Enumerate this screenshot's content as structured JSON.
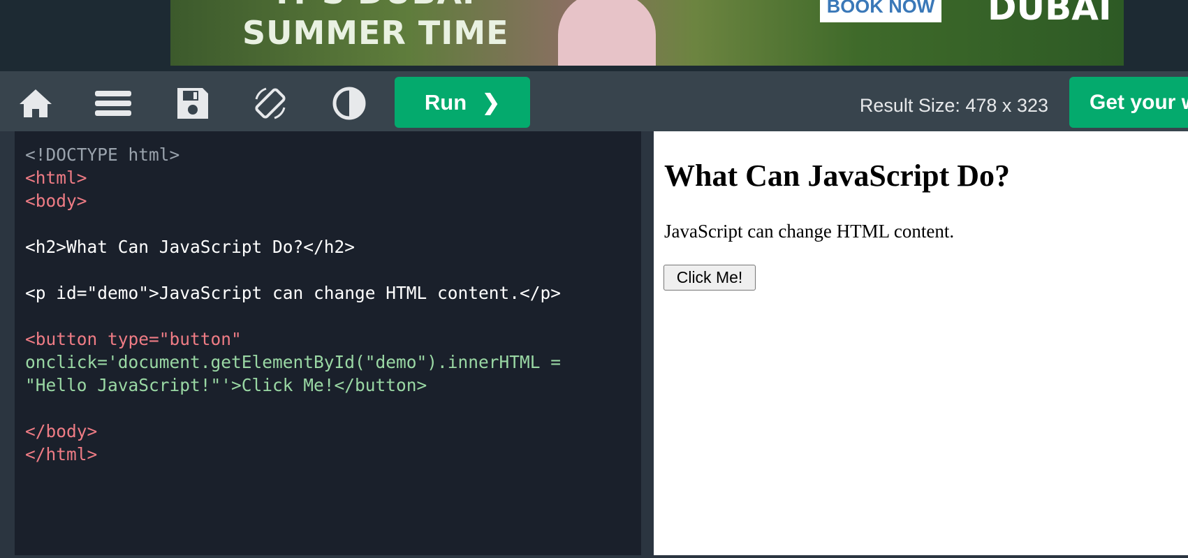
{
  "ad": {
    "line1": "IT'S DUBAI",
    "line2": "SUMMER TIME",
    "book_button": "BOOK NOW",
    "brand": "DUBAI"
  },
  "toolbar": {
    "run_label": "Run",
    "run_arrow": "❯",
    "result_size": "Result Size: 478 x 323",
    "get_button": "Get your w"
  },
  "editor": {
    "lines": [
      "<!DOCTYPE html>",
      "<html>",
      "<body>",
      "",
      "<h2>What Can JavaScript Do?</h2>",
      "",
      "<p id=\"demo\">JavaScript can change HTML content.</p>",
      "",
      "<button type=\"button\"",
      "onclick='document.getElementById(\"demo\").innerHTML =",
      "\"Hello JavaScript!\"'>Click Me!</button>",
      "",
      "</body>",
      "</html>"
    ]
  },
  "result": {
    "heading": "What Can JavaScript Do?",
    "paragraph": "JavaScript can change HTML content.",
    "button": "Click Me!"
  }
}
